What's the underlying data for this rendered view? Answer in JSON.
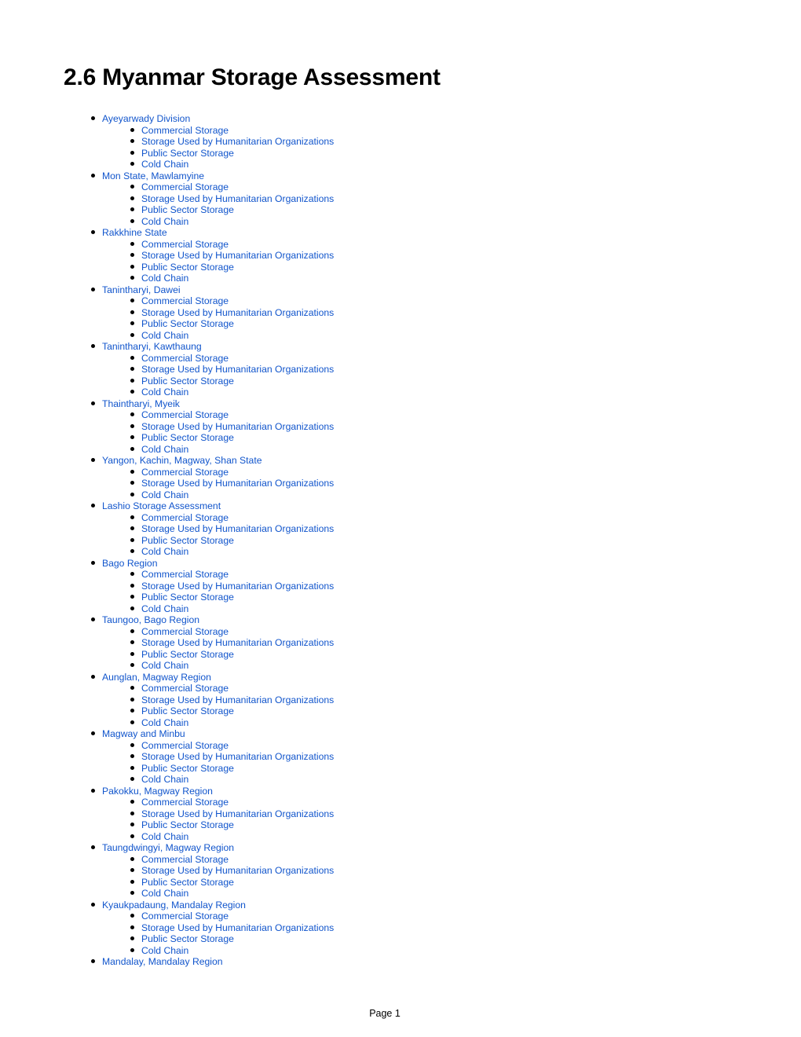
{
  "document": {
    "title": "2.6 Myanmar Storage Assessment",
    "footer": "Page 1",
    "link_color": "#1155cc"
  },
  "toc": [
    {
      "label": "Ayeyarwady Division",
      "children": [
        "Commercial Storage",
        "Storage Used by Humanitarian Organizations",
        "Public Sector Storage",
        "Cold Chain"
      ]
    },
    {
      "label": "Mon State, Mawlamyine",
      "children": [
        "Commercial Storage",
        "Storage Used by Humanitarian Organizations",
        "Public Sector Storage",
        "Cold Chain"
      ]
    },
    {
      "label": "Rakkhine State",
      "children": [
        "Commercial Storage",
        "Storage Used by Humanitarian Organizations",
        "Public Sector Storage",
        "Cold Chain"
      ]
    },
    {
      "label": "Tanintharyi, Dawei",
      "children": [
        "Commercial Storage",
        "Storage Used by Humanitarian Organizations",
        "Public Sector Storage",
        "Cold Chain"
      ]
    },
    {
      "label": "Tanintharyi, Kawthaung",
      "children": [
        "Commercial Storage",
        "Storage Used by Humanitarian Organizations",
        "Public Sector Storage",
        "Cold Chain"
      ]
    },
    {
      "label": "Thaintharyi, Myeik",
      "children": [
        "Commercial Storage",
        "Storage Used by Humanitarian Organizations",
        "Public Sector Storage",
        "Cold Chain"
      ]
    },
    {
      "label": "Yangon, Kachin, Magway, Shan State",
      "children": [
        "Commercial Storage",
        "Storage Used by Humanitarian Organizations",
        "Cold Chain"
      ]
    },
    {
      "label": "Lashio Storage Assessment",
      "children": [
        "Commercial Storage",
        "Storage Used by Humanitarian Organizations",
        "Public Sector Storage",
        "Cold Chain"
      ]
    },
    {
      "label": "Bago Region",
      "children": [
        "Commercial Storage",
        "Storage Used by Humanitarian Organizations",
        "Public Sector Storage",
        "Cold Chain"
      ]
    },
    {
      "label": "Taungoo, Bago Region",
      "children": [
        "Commercial Storage",
        "Storage Used by Humanitarian Organizations",
        "Public Sector Storage",
        "Cold Chain"
      ]
    },
    {
      "label": "Aunglan, Magway Region",
      "children": [
        "Commercial Storage",
        "Storage Used by Humanitarian Organizations",
        "Public Sector Storage",
        "Cold Chain"
      ]
    },
    {
      "label": "Magway and Minbu",
      "children": [
        "Commercial Storage",
        "Storage Used by Humanitarian Organizations",
        "Public Sector Storage",
        "Cold Chain"
      ]
    },
    {
      "label": "Pakokku, Magway Region",
      "children": [
        "Commercial Storage",
        "Storage Used by Humanitarian Organizations",
        "Public Sector Storage",
        "Cold Chain"
      ]
    },
    {
      "label": "Taungdwingyi, Magway Region",
      "children": [
        "Commercial Storage",
        "Storage Used by Humanitarian Organizations",
        "Public Sector Storage",
        "Cold Chain"
      ]
    },
    {
      "label": "Kyaukpadaung, Mandalay Region",
      "children": [
        "Commercial Storage",
        "Storage Used by Humanitarian Organizations",
        "Public Sector Storage",
        "Cold Chain"
      ]
    },
    {
      "label": "Mandalay, Mandalay Region",
      "children": []
    }
  ]
}
